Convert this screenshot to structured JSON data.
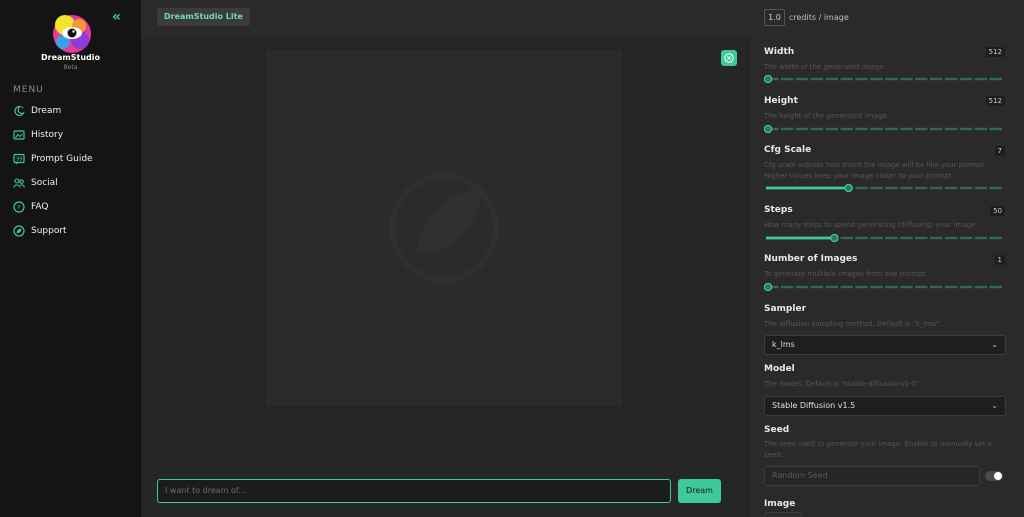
{
  "sidebar": {
    "brand": "DreamStudio",
    "brand_sub": "Beta",
    "menu_title": "MENU",
    "items": [
      {
        "label": "Dream",
        "icon": "dream-icon"
      },
      {
        "label": "History",
        "icon": "history-icon"
      },
      {
        "label": "Prompt Guide",
        "icon": "prompt-guide-icon"
      },
      {
        "label": "Social",
        "icon": "social-icon"
      },
      {
        "label": "FAQ",
        "icon": "faq-icon"
      },
      {
        "label": "Support",
        "icon": "support-icon"
      }
    ]
  },
  "topbar": {
    "badge": "DreamStudio Lite",
    "credits_value": "1.0",
    "credits_label": "credits / image"
  },
  "prompt": {
    "placeholder": "I want to dream of...",
    "button": "Dream"
  },
  "settings": {
    "width": {
      "label": "Width",
      "desc": "The width of the generated image.",
      "value": "512",
      "fraction": 0.0
    },
    "height": {
      "label": "Height",
      "desc": "The height of the generated image.",
      "value": "512",
      "fraction": 0.0
    },
    "cfg": {
      "label": "Cfg Scale",
      "desc": "Cfg scale adjusts how much the image will be like your prompt. Higher values keep your image closer to your prompt.",
      "value": "7",
      "fraction": 0.35
    },
    "steps": {
      "label": "Steps",
      "desc": "How many steps to spend generating (diffusing) your image.",
      "value": "50",
      "fraction": 0.29
    },
    "images": {
      "label": "Number of Images",
      "desc": "To generate multiple images from one prompt.",
      "value": "1",
      "fraction": 0.0
    },
    "sampler": {
      "label": "Sampler",
      "desc": "The diffusion sampling method. Default is \"k_lms\".",
      "selected": "k_lms"
    },
    "model": {
      "label": "Model",
      "desc": "The model. Default is \"stable-diffusion-v1-5\".",
      "selected": "Stable Diffusion v1.5"
    },
    "seed": {
      "label": "Seed",
      "desc": "The seed used to generate your image. Enable to manually set a seed.",
      "placeholder": "Random Seed"
    },
    "image": {
      "label": "Image"
    }
  },
  "colors": {
    "accent": "#3ec99a",
    "track": "#2f6a53"
  }
}
